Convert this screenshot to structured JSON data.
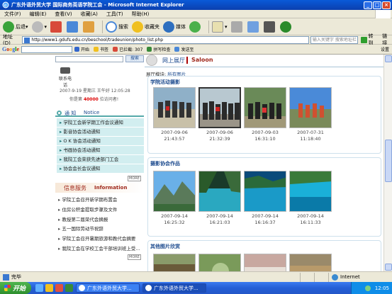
{
  "window": {
    "title": "广东外语外贸大学 国际商务英语学院工会 - Microsoft Internet Explorer",
    "buttons": [
      "_",
      "□",
      "×"
    ]
  },
  "menubar": [
    "文件(F)",
    "编辑(E)",
    "查看(V)",
    "收藏(A)",
    "工具(T)",
    "帮助(H)"
  ],
  "toolbar": {
    "back": "后退",
    "search": "搜索",
    "favorites": "收藏夹",
    "media": "媒体"
  },
  "addressbar": {
    "label": "地址(D)",
    "url": "http://www1.gdufs.edu.cn/beschool/tradeunion/photo_list.php",
    "search_placeholder": "输入关键字 搜索地址栏",
    "go": "转到",
    "links": "链接"
  },
  "googlebar": {
    "logo": "Google",
    "items": [
      "开始",
      "书签",
      "已拦截: 307",
      "拼写检查",
      "发送至"
    ],
    "settings": "设置"
  },
  "left": {
    "search_button": "搜索",
    "phone_label": "联系电话",
    "datetime": "2007-9-19 星期三 王午好 12:05:28",
    "visitors_prefix": "你是第",
    "visitors_count": "40000",
    "visitors_suffix": "位访问者!",
    "notice_title_cn": "通 知",
    "notice_title_en": "Notice",
    "notices": [
      "学院工会新学期工作会议通知",
      "影音协会活动通知",
      "O K 协会活动通知",
      "书画协会活动通知",
      "我院工会荣获先进部门工会",
      "协会会长会议通知"
    ],
    "more": "MORE",
    "info_title_cn": "信息服务",
    "info_title_en": "Information",
    "infos": [
      "学院工会召开新学期布置会",
      "住房公积金提取步骤及文件",
      "教授第二届荣代会摘报",
      "五一国际劳动节祝辞",
      "学院工会召开暑期旅游和教代会摘要",
      "我院工会在学校工会干部培训班上受..."
    ]
  },
  "right": {
    "header_cn": "网上展厅",
    "header_en": "Saloon",
    "crumb_prefix": "展厅模块:",
    "crumb_link": "所有图片",
    "sections": [
      {
        "title": "学院活动摄影",
        "photos": [
          {
            "date": "2007-09-06",
            "time": "21:43:57"
          },
          {
            "date": "2007-09-06",
            "time": "21:32:39"
          },
          {
            "date": "2007-09-03",
            "time": "16:31:10"
          },
          {
            "date": "2007-07-31",
            "time": "11:18:40"
          }
        ]
      },
      {
        "title": "摄影协会作品",
        "photos": [
          {
            "date": "2007-09-14",
            "time": "16:25:32"
          },
          {
            "date": "2007-09-14",
            "time": "16:21:03"
          },
          {
            "date": "2007-09-14",
            "time": "16:16:37"
          },
          {
            "date": "2007-09-14",
            "time": "16:11:33"
          }
        ]
      },
      {
        "title": "其他图片欣赏",
        "photos": []
      }
    ]
  },
  "statusbar": {
    "status": "完毕",
    "zone": "Internet"
  },
  "taskbar": {
    "start": "开始",
    "tasks": [
      "广东外语外贸大学...",
      "广东外语外贸大学..."
    ],
    "clock": "12:05"
  },
  "colors": {
    "accent": "#1d4b8f",
    "notice_bg": "#d2eef0",
    "info_red": "#a0291c"
  }
}
